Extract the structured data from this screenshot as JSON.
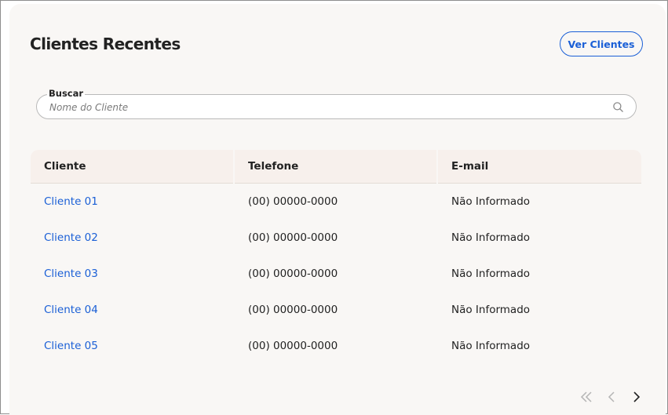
{
  "header": {
    "title": "Clientes Recentes",
    "view_button": "Ver Clientes"
  },
  "search": {
    "label": "Buscar",
    "placeholder": "Nome do Cliente",
    "value": ""
  },
  "table": {
    "columns": [
      "Cliente",
      "Telefone",
      "E-mail"
    ],
    "rows": [
      {
        "cliente": "Cliente 01",
        "telefone": "(00) 00000-0000",
        "email": "Não Informado"
      },
      {
        "cliente": "Cliente 02",
        "telefone": "(00) 00000-0000",
        "email": "Não Informado"
      },
      {
        "cliente": "Cliente 03",
        "telefone": "(00) 00000-0000",
        "email": "Não Informado"
      },
      {
        "cliente": "Cliente 04",
        "telefone": "(00) 00000-0000",
        "email": "Não Informado"
      },
      {
        "cliente": "Cliente 05",
        "telefone": "(00) 00000-0000",
        "email": "Não Informado"
      }
    ]
  },
  "pagination": {
    "first_enabled": false,
    "prev_enabled": false,
    "next_enabled": true
  },
  "colors": {
    "accent": "#1a5fd6",
    "card_bg": "#f9f7f5",
    "header_bg": "#f7f0ec",
    "disabled": "#b5b5b5",
    "text": "#222222"
  },
  "icons": {
    "search": "search-icon",
    "first_page": "double-chevron-left-icon",
    "prev_page": "chevron-left-icon",
    "next_page": "chevron-right-icon"
  }
}
